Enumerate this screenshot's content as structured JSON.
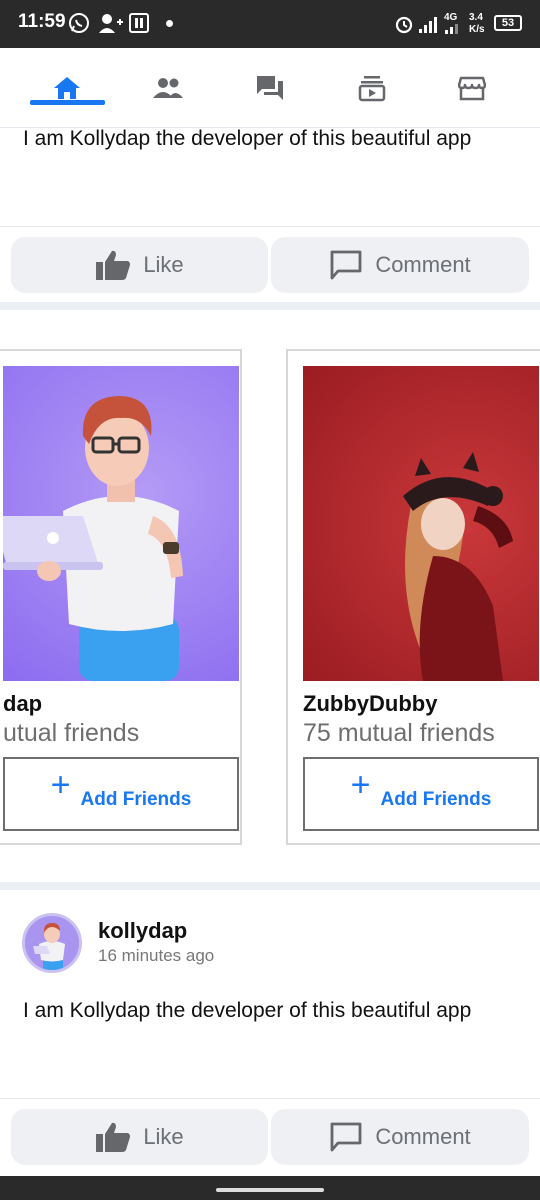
{
  "status_bar": {
    "time": "11:59",
    "network_label": "4G",
    "speed_value": "3.4",
    "speed_unit": "K/s",
    "battery": "53"
  },
  "nav": {
    "tabs": [
      {
        "name": "home",
        "icon": "home-icon",
        "active": true
      },
      {
        "name": "friends",
        "icon": "people-icon",
        "active": false
      },
      {
        "name": "messages",
        "icon": "chat-icon",
        "active": false
      },
      {
        "name": "watch",
        "icon": "video-icon",
        "active": false
      },
      {
        "name": "marketplace",
        "icon": "store-icon",
        "active": false
      }
    ],
    "accent_color": "#1877f2"
  },
  "post1": {
    "text_partial": "I am Kollydap the developer of this beautiful app",
    "like_label": "Like",
    "comment_label": "Comment"
  },
  "friend_suggestions": {
    "cards": [
      {
        "name": "dap",
        "mutual": "utual friends",
        "add_label": "Add Friends"
      },
      {
        "name": "ZubbyDubby",
        "mutual": "75 mutual friends",
        "add_label": "Add Friends"
      }
    ]
  },
  "post2": {
    "author": "kollydap",
    "time_ago": "16 minutes ago",
    "text": "I am Kollydap the developer of this beautiful app",
    "like_label": "Like",
    "comment_label": "Comment"
  }
}
